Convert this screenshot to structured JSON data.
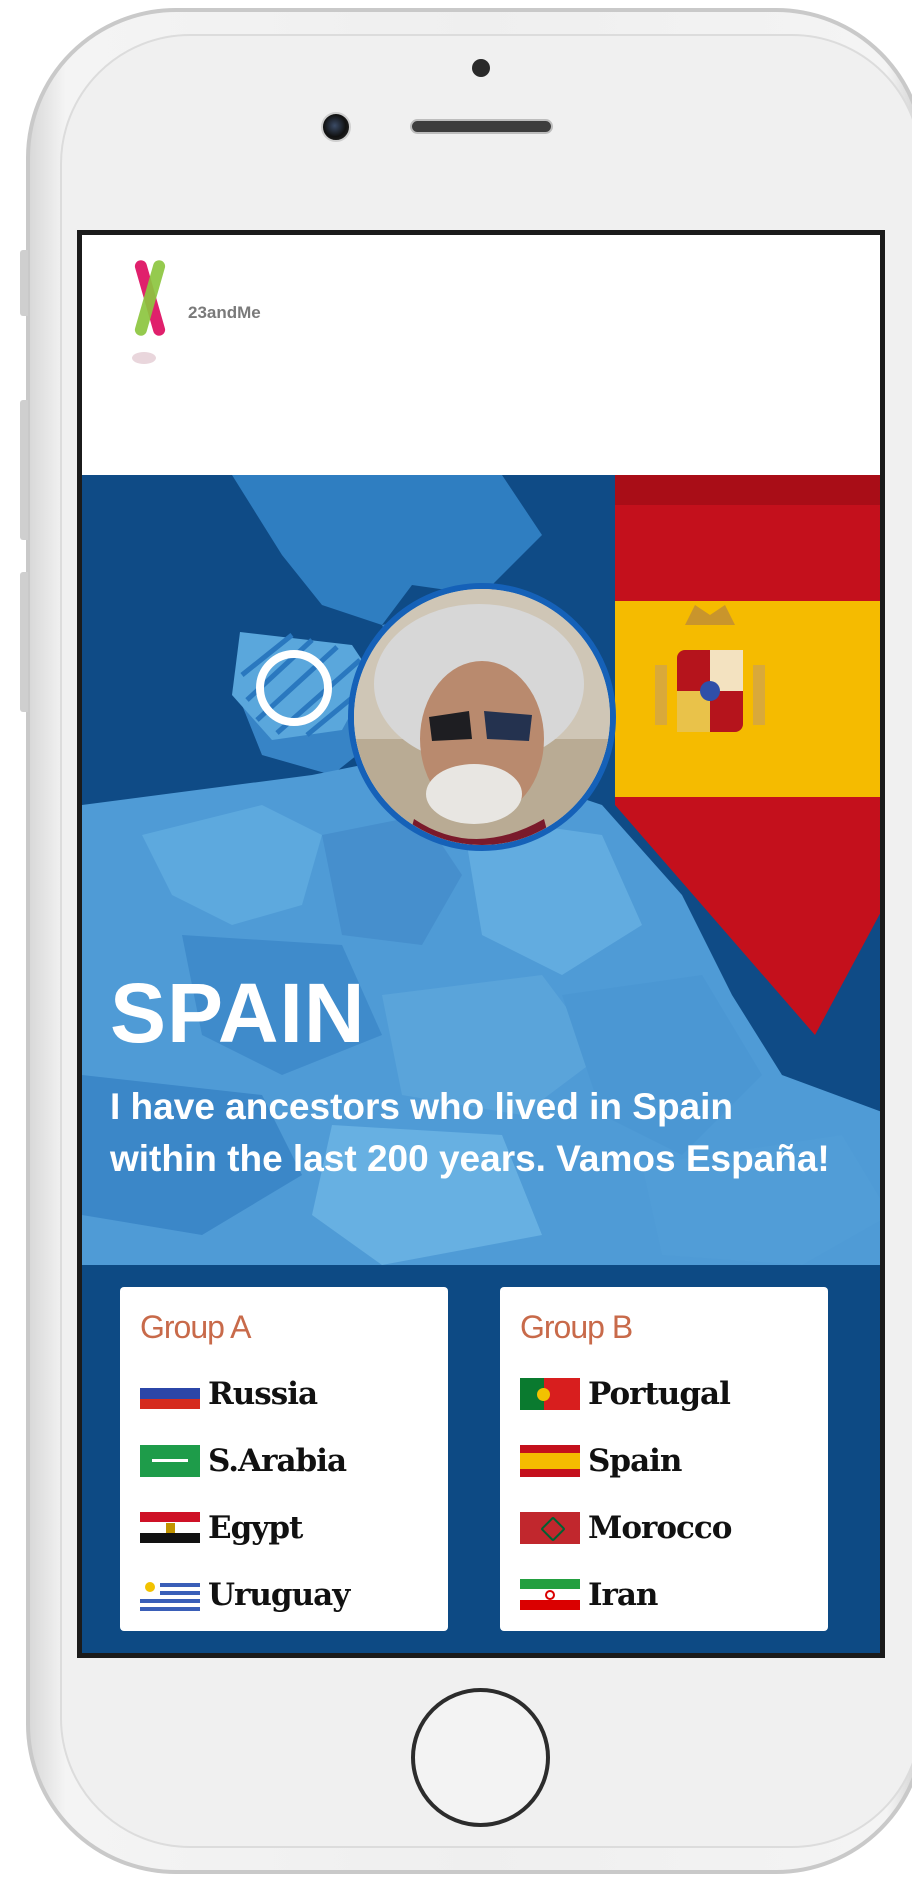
{
  "brand": {
    "logo_text": "23andMe"
  },
  "hero": {
    "country": "SPAIN",
    "message": "I have ancestors who lived in Spain within the last 200 years. Vamos España!"
  },
  "groups": [
    {
      "title": "Group A",
      "teams": [
        {
          "name": "Russia",
          "flag": "russia-flag"
        },
        {
          "name": "S.Arabia",
          "flag": "saudi-arabia-flag"
        },
        {
          "name": "Egypt",
          "flag": "egypt-flag"
        },
        {
          "name": "Uruguay",
          "flag": "uruguay-flag"
        }
      ]
    },
    {
      "title": "Group B",
      "teams": [
        {
          "name": "Portugal",
          "flag": "portugal-flag"
        },
        {
          "name": "Spain",
          "flag": "spain-flag"
        },
        {
          "name": "Morocco",
          "flag": "morocco-flag"
        },
        {
          "name": "Iran",
          "flag": "iran-flag"
        }
      ]
    }
  ],
  "colors": {
    "map_dark": "#0f4b86",
    "map_light": "#5aa7dc",
    "group_panel": "#0d4a84",
    "group_title": "#c86a4a",
    "flag_red": "#c4101c",
    "flag_yellow": "#f5bb00"
  }
}
